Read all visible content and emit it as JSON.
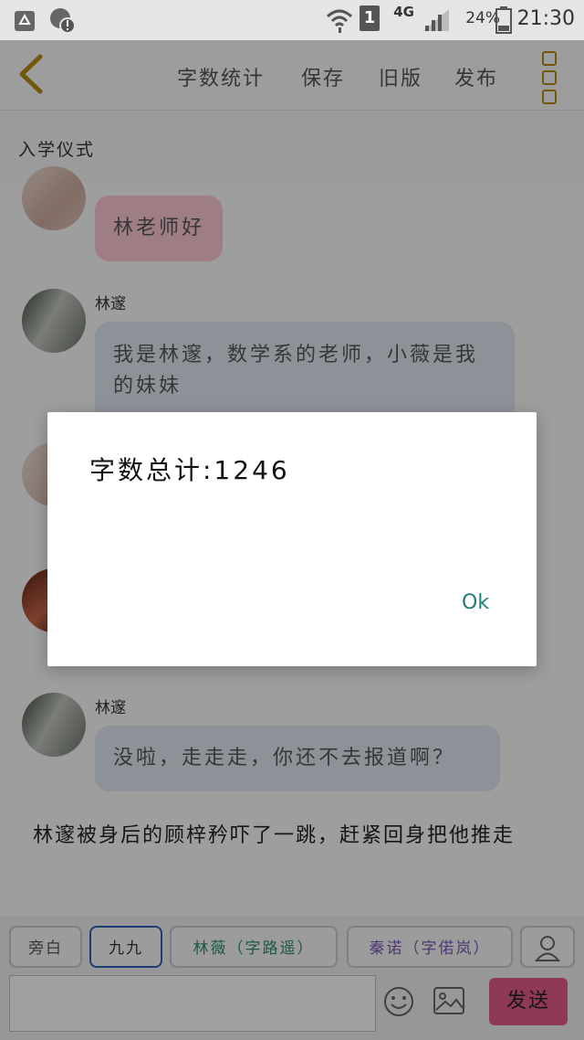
{
  "status_bar": {
    "network": "4G",
    "sim": "1",
    "battery": "24%",
    "time": "21:30"
  },
  "header": {
    "menu": [
      "字数统计",
      "保存",
      "旧版",
      "发布"
    ]
  },
  "doc_title": "入学仪式",
  "chat": {
    "bubble1": "林老师好",
    "speaker": "林邃",
    "bubble2": "我是林邃，数学系的老师，小薇是我的妹妹",
    "bubble3": "没啦，走走走，你还不去报道啊？",
    "narration": "林邃被身后的顾梓矜吓了一跳，赶紧回身把他推走"
  },
  "dialog": {
    "message": "字数总计:1246",
    "ok_label": "Ok"
  },
  "bottom": {
    "chips": [
      "旁白",
      "九九",
      "林薇（字路遥）",
      "秦诺（字偌岚）"
    ],
    "chip_colors": [
      "#555555",
      "#333333",
      "#2f8a6a",
      "#7a58b5"
    ],
    "send_label": "发送"
  }
}
